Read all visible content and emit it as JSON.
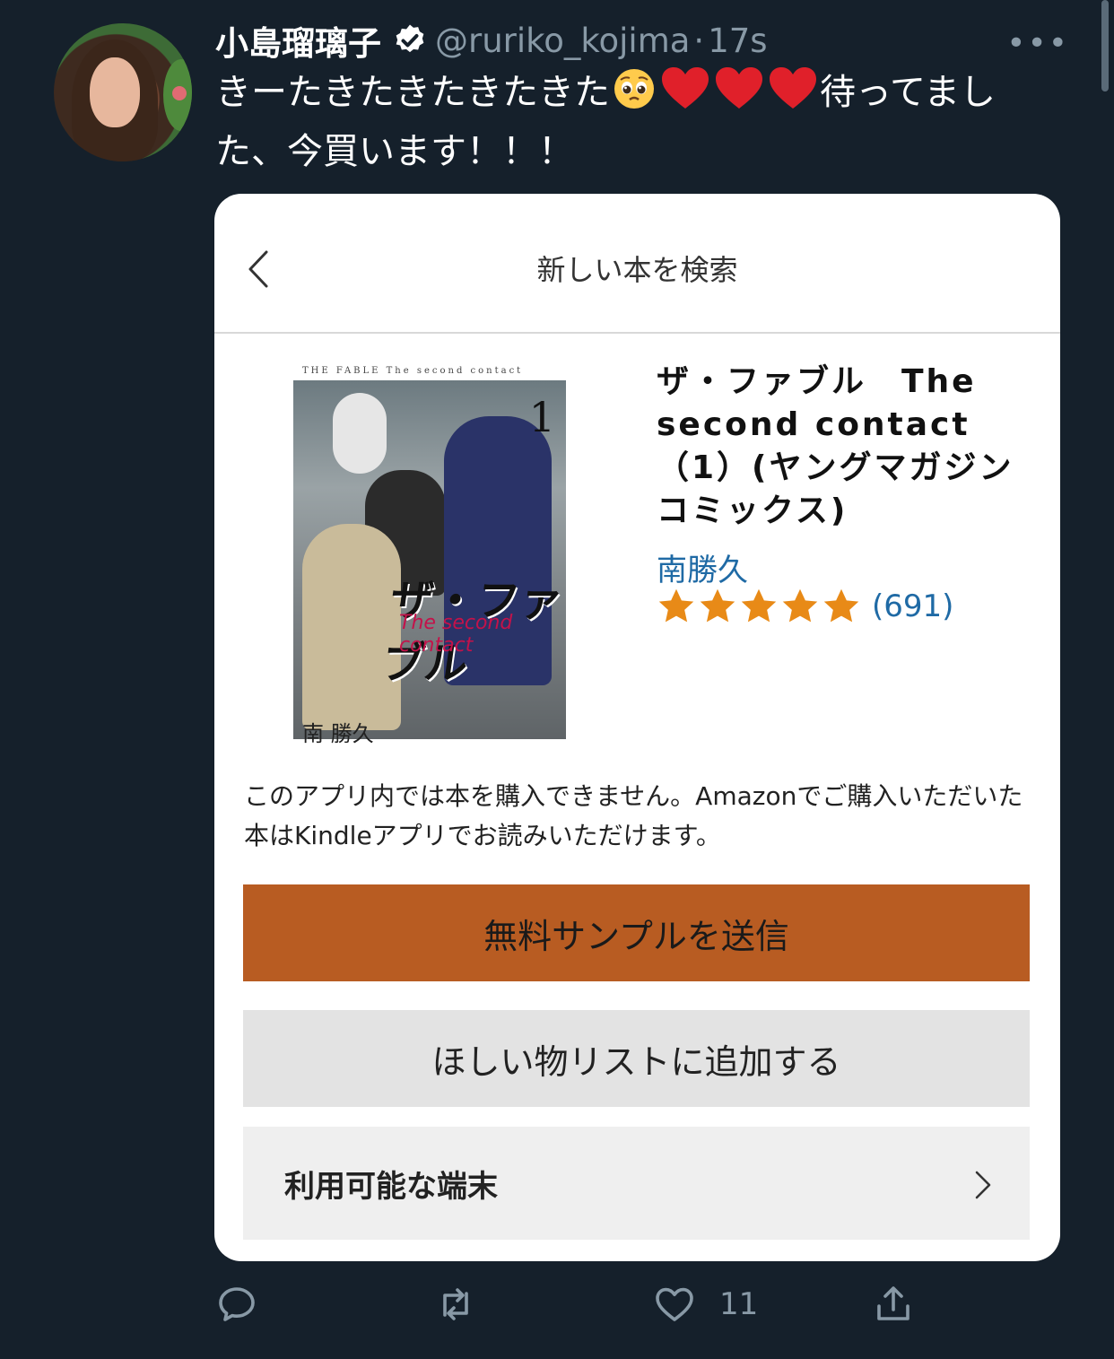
{
  "tweet": {
    "author_name": "小島瑠璃子",
    "handle": "@ruriko_kojima",
    "separator": "·",
    "time": "17s",
    "more": "•••",
    "text_before_emoji": "きーたきたきたきたきた",
    "text_after_emoji": "待ってました、今買います！！！",
    "emojis": [
      "pleading-face",
      "red-heart",
      "red-heart",
      "red-heart"
    ]
  },
  "card": {
    "header_title": "新しい本を検索",
    "cover_top_text": "THE FABLE  The second contact",
    "cover_number": "1",
    "cover_logo": "ザ・ファブル",
    "cover_subtitle": "The second contact",
    "cover_author": "南 勝久",
    "book_title": "ザ・ファブル　The second contact（1）(ヤングマガジンコミックス)",
    "author": "南勝久",
    "rating_stars": 5,
    "rating_count": "(691)",
    "notice": "このアプリ内では本を購入できません。Amazonでご購入いただいた本はKindleアプリでお読みいただけます。",
    "btn_sample": "無料サンプルを送信",
    "btn_wishlist": "ほしい物リストに追加する",
    "btn_devices": "利用可能な端末"
  },
  "actions": {
    "reply_count": "",
    "retweet_count": "",
    "like_count": "11",
    "share_count": ""
  },
  "colors": {
    "background": "#15202b",
    "secondary_text": "#8899a6",
    "amazon_orange": "#b85c22",
    "link_blue": "#1f6aa5",
    "star": "#e88a17"
  }
}
